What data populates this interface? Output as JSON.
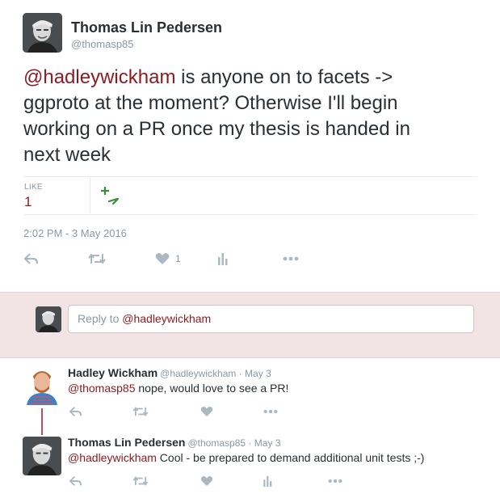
{
  "tweet": {
    "author_name": "Thomas Lin Pedersen",
    "author_handle": "@thomasp85",
    "text_mention": "@hadleywickham",
    "text_line1_rest": " is anyone on to facets ->",
    "text_line2": "ggproto at the moment? Otherwise I'll begin",
    "text_line3": "working on a PR once my thesis is handed in",
    "text_line4": "next week",
    "like_label": "LIKE",
    "like_count": "1",
    "timestamp": "2:02 PM - 3 May 2016",
    "action_like_count": "1"
  },
  "reply_box": {
    "prefix": "Reply to ",
    "mention": "@hadleywickham"
  },
  "replies": [
    {
      "name": "Hadley Wickham",
      "meta": "@hadleywickham · May 3",
      "mention": "@thomasp85",
      "text": " nope, would love to see a PR!"
    },
    {
      "name": "Thomas Lin Pedersen",
      "meta": "@thomasp85 · May 3",
      "mention": "@hadleywickham",
      "text": " Cool - be prepared to demand additional unit tests ;-)"
    }
  ],
  "icons": [
    "reply-icon",
    "retweet-icon",
    "heart-icon",
    "analytics-icon",
    "more-icon",
    "plus-arrow-icon"
  ],
  "colors": {
    "mention": "#8b1d22",
    "muted": "#8899a6",
    "plus_icon": "#3b8c3b",
    "reply_band": "#f2e4e4",
    "thread_line": "#b2525a"
  }
}
